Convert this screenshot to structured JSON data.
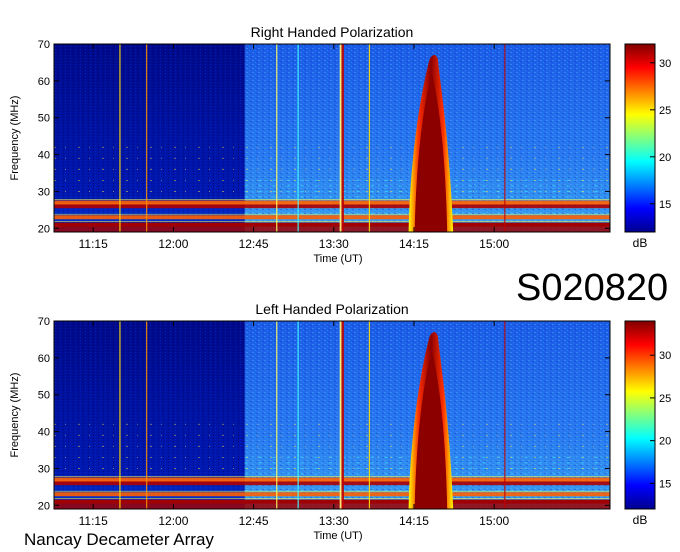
{
  "observation_id": "S020820",
  "instrument": "Nancay Decameter Array",
  "colors": {
    "colormap": [
      "#00008f",
      "#0000ff",
      "#0080ff",
      "#00ffff",
      "#80ff80",
      "#ffff00",
      "#ff8000",
      "#ff0000",
      "#800000"
    ],
    "background_dark": "#000a8a",
    "background_mid": "#1a5ae8",
    "burst": "#8c0000"
  },
  "chart_data": [
    {
      "type": "heatmap",
      "title": "Right Handed Polarization",
      "xlabel": "Time (UT)",
      "ylabel": "Frequency (MHz)",
      "xticks": [
        "11:15",
        "12:00",
        "12:45",
        "13:30",
        "14:15",
        "15:00"
      ],
      "xlim": [
        "10:53",
        "16:05"
      ],
      "yticks": [
        20,
        30,
        40,
        50,
        60,
        70
      ],
      "ylim": [
        19,
        70
      ],
      "colorbar": {
        "label": "dB",
        "ticks": [
          15,
          20,
          25,
          30
        ],
        "range": [
          12,
          32
        ]
      },
      "features": {
        "quiet_until": "12:40",
        "burst": {
          "start": "14:12",
          "peak": "14:25",
          "end": "14:37",
          "max_freq_mhz": 70,
          "level_db": 32
        },
        "interference_bands_mhz": [
          21,
          23,
          26,
          27
        ],
        "vertical_lines": [
          "11:30",
          "11:45",
          "12:58",
          "13:10",
          "13:34",
          "13:35",
          "13:50",
          "15:06"
        ]
      }
    },
    {
      "type": "heatmap",
      "title": "Left Handed Polarization",
      "xlabel": "Time (UT)",
      "ylabel": "Frequency (MHz)",
      "xticks": [
        "11:15",
        "12:00",
        "12:45",
        "13:30",
        "14:15",
        "15:00"
      ],
      "xlim": [
        "10:53",
        "16:05"
      ],
      "yticks": [
        20,
        30,
        40,
        50,
        60,
        70
      ],
      "ylim": [
        19,
        70
      ],
      "colorbar": {
        "label": "dB",
        "ticks": [
          15,
          20,
          25,
          30
        ],
        "range": [
          12,
          34
        ]
      },
      "features": {
        "quiet_until": "12:40",
        "burst": {
          "start": "14:12",
          "peak": "14:25",
          "end": "14:37",
          "max_freq_mhz": 70,
          "level_db": 34
        },
        "interference_bands_mhz": [
          21,
          23,
          26,
          27
        ],
        "vertical_lines": [
          "11:30",
          "11:45",
          "12:58",
          "13:10",
          "13:34",
          "13:35",
          "13:50",
          "15:06"
        ]
      }
    }
  ]
}
